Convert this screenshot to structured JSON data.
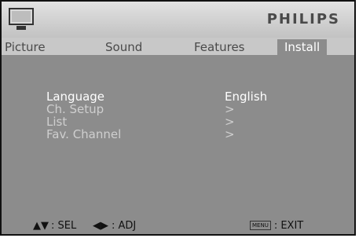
{
  "header": {
    "brand": "PHILIPS",
    "icon": "tv-icon"
  },
  "tabs": [
    {
      "label": "Picture",
      "active": false
    },
    {
      "label": "Sound",
      "active": false
    },
    {
      "label": "Features",
      "active": false
    },
    {
      "label": "Install",
      "active": true
    }
  ],
  "menu": {
    "items": [
      {
        "label": "Language",
        "value": "English",
        "selected": true
      },
      {
        "label": "Ch. Setup",
        "value": ">",
        "selected": false
      },
      {
        "label": "List",
        "value": ">",
        "selected": false
      },
      {
        "label": "Fav. Channel",
        "value": ">",
        "selected": false
      }
    ]
  },
  "footer": {
    "sel_keys": "▲▼",
    "sel_label": ": SEL",
    "adj_keys": "◀▶",
    "adj_label": ": ADJ",
    "menu_key": "MENU",
    "exit_label": ": EXIT"
  },
  "colors": {
    "panel": "#8c8c8c",
    "header": "#c8c8c8",
    "selected_text": "#ffffff",
    "dim_text": "#cfcfcf"
  }
}
